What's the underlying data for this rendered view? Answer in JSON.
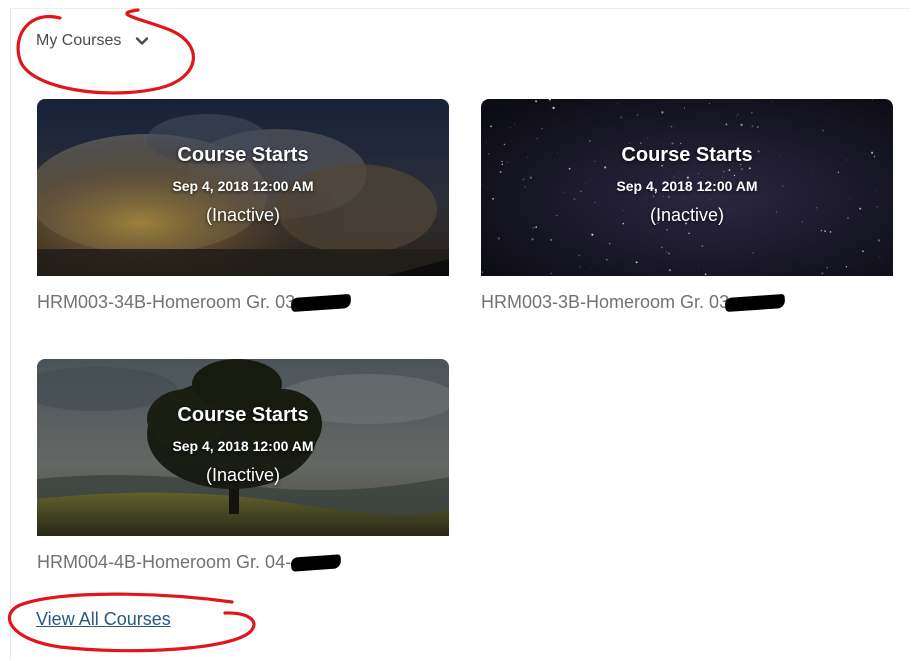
{
  "widget": {
    "title": "My Courses",
    "view_all_label": "View All Courses"
  },
  "courses": [
    {
      "overlay_title": "Course Starts",
      "overlay_date": "Sep 4, 2018 12:00 AM",
      "overlay_status": "(Inactive)",
      "name": "HRM003-34B-Homeroom Gr. 03",
      "image": "clouds-sunset"
    },
    {
      "overlay_title": "Course Starts",
      "overlay_date": "Sep 4, 2018 12:00 AM",
      "overlay_status": "(Inactive)",
      "name": "HRM003-3B-Homeroom Gr. 03",
      "image": "night-sky-stars"
    },
    {
      "overlay_title": "Course Starts",
      "overlay_date": "Sep 4, 2018 12:00 AM",
      "overlay_status": "(Inactive)",
      "name": "HRM004-4B-Homeroom Gr. 04-",
      "image": "lone-tree-field"
    }
  ],
  "colors": {
    "link": "#29587f",
    "text": "#494c4e",
    "course_name": "#6e7376",
    "annotation": "#e0161b"
  }
}
